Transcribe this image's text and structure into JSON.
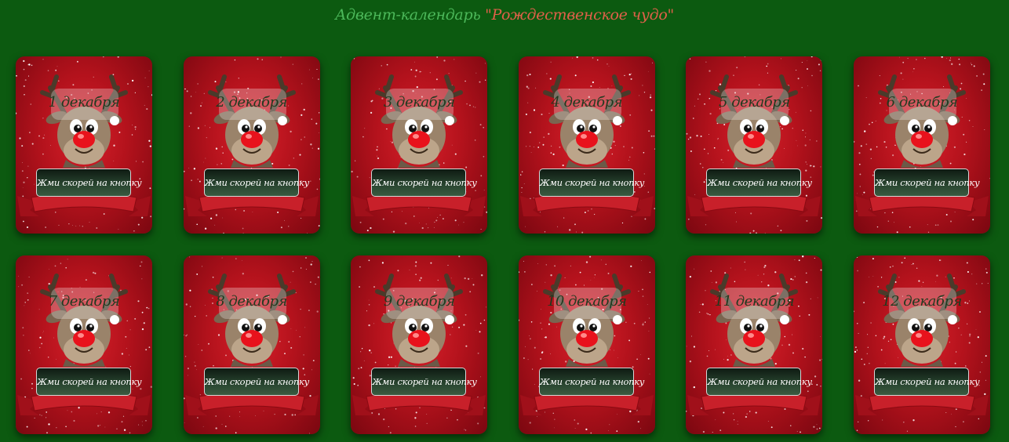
{
  "title": {
    "part1": "Адвент-календарь ",
    "part2": "\"Рождественское чудо\""
  },
  "colors": {
    "background": "#0c5a10",
    "card": "#c41520",
    "title_green": "#4cb85a",
    "title_red": "#e0604a"
  },
  "button_label": "Жми скорей на кнопку",
  "cards": [
    {
      "date": "1 декабря"
    },
    {
      "date": "2 декабря"
    },
    {
      "date": "3 декабря"
    },
    {
      "date": "4 декабря"
    },
    {
      "date": "5 декабря"
    },
    {
      "date": "6 декабря"
    },
    {
      "date": "7 декабря"
    },
    {
      "date": "8 декабря"
    },
    {
      "date": "9 декабря"
    },
    {
      "date": "10 декабря"
    },
    {
      "date": "11 декабря"
    },
    {
      "date": "12 декабря"
    }
  ]
}
